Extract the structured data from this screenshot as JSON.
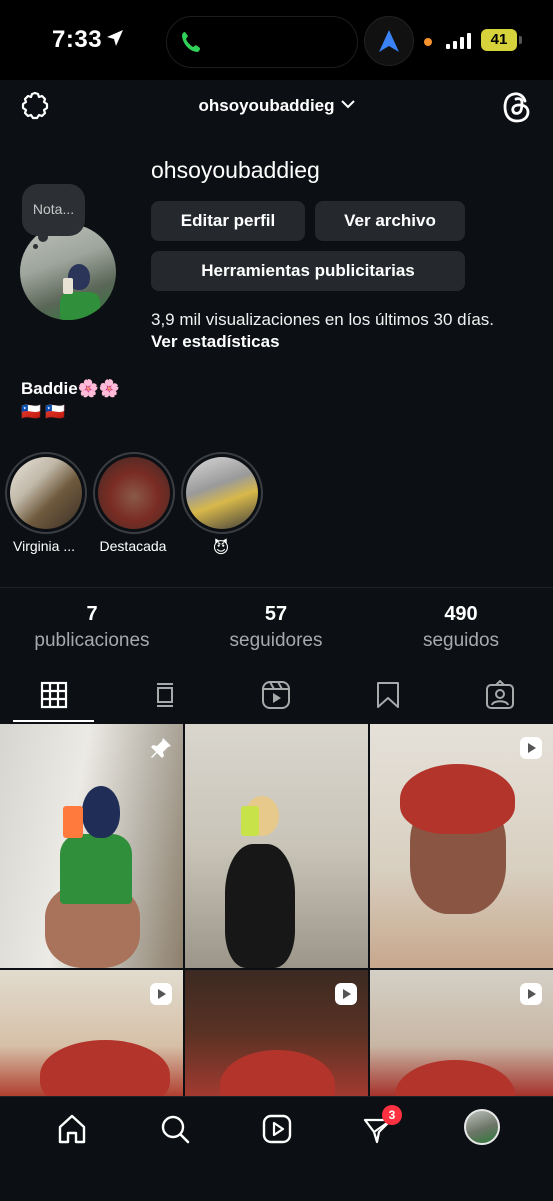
{
  "status_bar": {
    "time": "7:33",
    "battery": "41",
    "accent_colors": {
      "call": "#30d158",
      "nav": "#3b82f6",
      "dot": "#f7932e",
      "battery": "#d6d23b"
    }
  },
  "header": {
    "username": "ohsoyoubaddieg",
    "icons": [
      "settings-icon",
      "chevron-down-icon",
      "threads-icon"
    ]
  },
  "profile": {
    "name": "ohsoyoubaddieg",
    "note_placeholder": "Nota...",
    "buttons": {
      "edit": "Editar perfil",
      "archive": "Ver archivo",
      "ad_tools": "Herramientas publicitarias"
    },
    "views_text": "3,9 mil visualizaciones en los últimos 30 días.",
    "stats_link": "Ver estadísticas",
    "bio_line1": "Baddie🌸🌸",
    "bio_line2": "🇨🇱 🇨🇱"
  },
  "highlights": [
    {
      "label": "Virginia ..."
    },
    {
      "label": "Destacada"
    },
    {
      "label": "😈"
    }
  ],
  "stats": {
    "posts": {
      "count": "7",
      "label": "publicaciones"
    },
    "followers": {
      "count": "57",
      "label": "seguidores"
    },
    "following": {
      "count": "490",
      "label": "seguidos"
    }
  },
  "tabs": [
    "grid-icon",
    "feed-icon",
    "reels-icon",
    "saved-icon",
    "tagged-icon"
  ],
  "grid": [
    {
      "type": "pinned-photo"
    },
    {
      "type": "photo"
    },
    {
      "type": "reel"
    },
    {
      "type": "reel"
    },
    {
      "type": "reel"
    },
    {
      "type": "reel"
    }
  ],
  "bottom_nav": {
    "items": [
      "home-icon",
      "search-icon",
      "reels-icon",
      "activity-icon",
      "profile-avatar"
    ],
    "notification_count": "3"
  }
}
